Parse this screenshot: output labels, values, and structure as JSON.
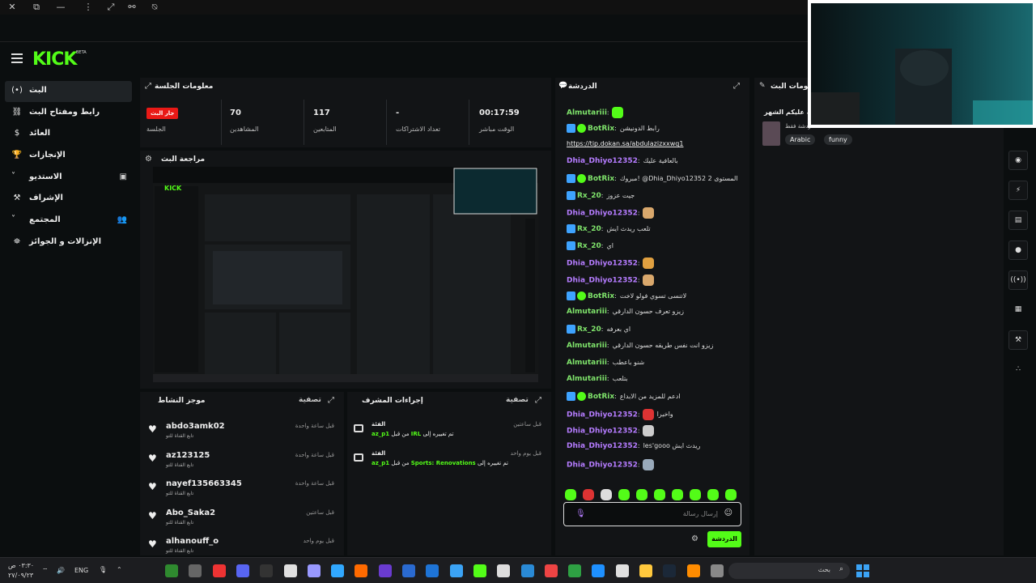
{
  "window": {
    "controls": [
      "✕",
      "⧉",
      "—",
      "⋮",
      "⤢",
      "⚯",
      "⍉"
    ]
  },
  "brand": {
    "logo": "KICK",
    "beta": "BETA"
  },
  "sidebar": {
    "items": [
      {
        "label": "البث",
        "icon": "(•)",
        "active": true
      },
      {
        "label": "رابط ومفتاح البث",
        "icon": "⛓"
      },
      {
        "label": "العائد",
        "icon": "$"
      },
      {
        "label": "الإنجازات",
        "icon": "🏆"
      },
      {
        "label": "الاستديو",
        "icon": "˅"
      },
      {
        "label": "الإشراف",
        "icon": "⚒"
      },
      {
        "label": "المجتمع",
        "icon": "˅"
      },
      {
        "label": "الإنزالات و الجوائز",
        "icon": "⛯"
      }
    ]
  },
  "session": {
    "title": "معلومات الجلسة",
    "live_badge": "جار البث",
    "live_label": "الجلسة",
    "stats": [
      {
        "value": "70",
        "label": "المشاهدين"
      },
      {
        "value": "117",
        "label": "المتابعين"
      },
      {
        "value": "-",
        "label": "تعداد الاشتراكات"
      },
      {
        "value": "00:17:59",
        "label": "الوقت مباشر"
      }
    ]
  },
  "preview": {
    "title": "مراجعة البث",
    "inner_logo": "KICK"
  },
  "activity": {
    "title": "موجز النشاط",
    "filter": "تصفية",
    "items": [
      {
        "name": "abdo3amk02",
        "sub": "تابع القناة للتو",
        "time": "قبل ساعة واحدة"
      },
      {
        "name": "az123125",
        "sub": "تابع القناة للتو",
        "time": "قبل ساعة واحدة"
      },
      {
        "name": "nayef135663345",
        "sub": "تابع القناة للتو",
        "time": "قبل ساعة واحدة"
      },
      {
        "name": "Abo_Saka2",
        "sub": "تابع القناة للتو",
        "time": "قبل ساعتين"
      },
      {
        "name": "alhanouff_o",
        "sub": "تابع القناة للتو",
        "time": "قبل يوم واحد"
      }
    ]
  },
  "mod_actions": {
    "title": "إجراءات المشرف",
    "filter": "تصفية",
    "items": [
      {
        "title": "الفئة",
        "text_a": "تم تغييره إلى",
        "text_b": "IRL",
        "text_c": "من قبل",
        "user": "az_p1",
        "time": "قبل ساعتين"
      },
      {
        "title": "الفئة",
        "text_a": "تم تغييره إلى",
        "text_b": "Sports: Renovations",
        "text_c": "من قبل",
        "user": "az_p1",
        "time": "قبل يوم واحد"
      }
    ]
  },
  "chat": {
    "title": "الدردشة",
    "input_placeholder": "إرسال رسالة",
    "send_label": "الدردشة",
    "colors": {
      "purple": "#b57cff",
      "green": "#53fc18",
      "user_green": "#7fe36b"
    },
    "messages": [
      {
        "user": "Almutariii",
        "msg": "",
        "color": "green",
        "badges": [],
        "emote": "#53fc18"
      },
      {
        "user": "BotRix",
        "msg": "رابط الدونيشن",
        "color": "green",
        "badges": [
          "mod",
          "verified"
        ]
      },
      {
        "user": "",
        "msg": "https://tip.dokan.sa/abdulazizxxwq1",
        "color": "link",
        "badges": []
      },
      {
        "user": "Dhia_Dhiyo12352",
        "msg": "بالعافية عليك",
        "color": "purple",
        "badges": []
      },
      {
        "user": "BotRix",
        "msg": "مبروك! @Dhia_Dhiyo12352 وصلت إلى المستوى 2",
        "color": "green",
        "badges": [
          "mod",
          "verified"
        ]
      },
      {
        "user": "Rx_20",
        "msg": "جيت عزوز",
        "color": "green",
        "badges": [
          "mod"
        ]
      },
      {
        "user": "Dhia_Dhiyo12352",
        "msg": "",
        "color": "purple",
        "badges": [],
        "emote": "#d9a86c"
      },
      {
        "user": "Rx_20",
        "msg": "تلعب ريدث ايش",
        "color": "green",
        "badges": [
          "mod"
        ]
      },
      {
        "user": "Rx_20",
        "msg": "اي",
        "color": "green",
        "badges": [
          "mod"
        ]
      },
      {
        "user": "Dhia_Dhiyo12352",
        "msg": "",
        "color": "purple",
        "badges": [],
        "emote": "#e0a040"
      },
      {
        "user": "Dhia_Dhiyo12352",
        "msg": "",
        "color": "purple",
        "badges": [],
        "emote": "#d9a86c"
      },
      {
        "user": "BotRix",
        "msg": "لاتنسى تسوي فولو لاخت",
        "color": "green",
        "badges": [
          "mod",
          "verified"
        ]
      },
      {
        "user": "Almutariii",
        "msg": "زيزو تعرف حسون الدارقي",
        "color": "green",
        "badges": []
      },
      {
        "user": "Rx_20",
        "msg": "اي بعرفه",
        "color": "green",
        "badges": [
          "mod"
        ]
      },
      {
        "user": "Almutariii",
        "msg": "زيزو انت نفس طريقه حسون الدارقي",
        "color": "green",
        "badges": []
      },
      {
        "user": "Almutariii",
        "msg": "شنو باعطب",
        "color": "green",
        "badges": []
      },
      {
        "user": "Almutariii",
        "msg": "بتلعب",
        "color": "green",
        "badges": []
      },
      {
        "user": "BotRix",
        "msg": "ادعم للمزيد من الابداع",
        "color": "green",
        "badges": [
          "mod",
          "verified"
        ]
      },
      {
        "user": "Dhia_Dhiyo12352",
        "msg": "واخيرا",
        "color": "purple",
        "badges": [],
        "emote": "#d33"
      },
      {
        "user": "Dhia_Dhiyo12352",
        "msg": "",
        "color": "purple",
        "badges": [],
        "emote": "#ccc"
      },
      {
        "user": "Dhia_Dhiyo12352",
        "msg": "les'gooo ريدث ايش",
        "color": "purple",
        "badges": []
      },
      {
        "user": "Dhia_Dhiyo12352",
        "msg": "",
        "color": "purple",
        "badges": [],
        "emote": "#9ab"
      }
    ]
  },
  "stream_info": {
    "title": "معلومات البث",
    "text": "مبارك عليكم الشهر",
    "sub": "دردشة فقط",
    "tags": [
      "Arabic",
      "funny"
    ]
  },
  "taskbar": {
    "search": "بحث",
    "lang": "ENG",
    "time": "٠٣:٣٠ ص",
    "date": "٢٧/٠٩/٢٣"
  }
}
